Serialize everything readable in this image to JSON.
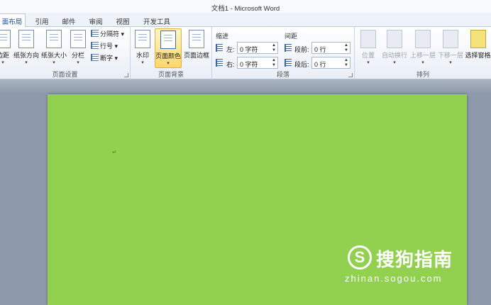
{
  "window": {
    "title": "文档1 - Microsoft Word"
  },
  "tabs": [
    {
      "label": "面布局",
      "active": true
    },
    {
      "label": "引用",
      "active": false
    },
    {
      "label": "邮件",
      "active": false
    },
    {
      "label": "审阅",
      "active": false
    },
    {
      "label": "视图",
      "active": false
    },
    {
      "label": "开发工具",
      "active": false
    }
  ],
  "ribbon": {
    "page_setup": {
      "label": "页面设置",
      "buttons": [
        "边距",
        "纸张方向",
        "纸张大小",
        "分栏"
      ],
      "small": [
        "分隔符",
        "行号",
        "断字"
      ]
    },
    "page_background": {
      "label": "页面背景",
      "buttons": [
        "水印",
        "页面颜色",
        "页面边框"
      ]
    },
    "paragraph": {
      "label": "段落",
      "indent_heading": "缩进",
      "spacing_heading": "间距",
      "left_label": "左:",
      "left_value": "0 字符",
      "right_label": "右:",
      "right_value": "0 字符",
      "before_label": "段前:",
      "before_value": "0 行",
      "after_label": "段后:",
      "after_value": "0 行"
    },
    "arrange": {
      "label": "排列",
      "buttons": [
        "位置",
        "自动换行",
        "上移一层",
        "下移一层",
        "选择窗格"
      ]
    }
  },
  "document": {
    "page_color": "#92d050",
    "mark": "↵"
  },
  "watermark": {
    "logo": "S",
    "text": "搜狗指南",
    "url": "zhinan.sogou.com"
  }
}
